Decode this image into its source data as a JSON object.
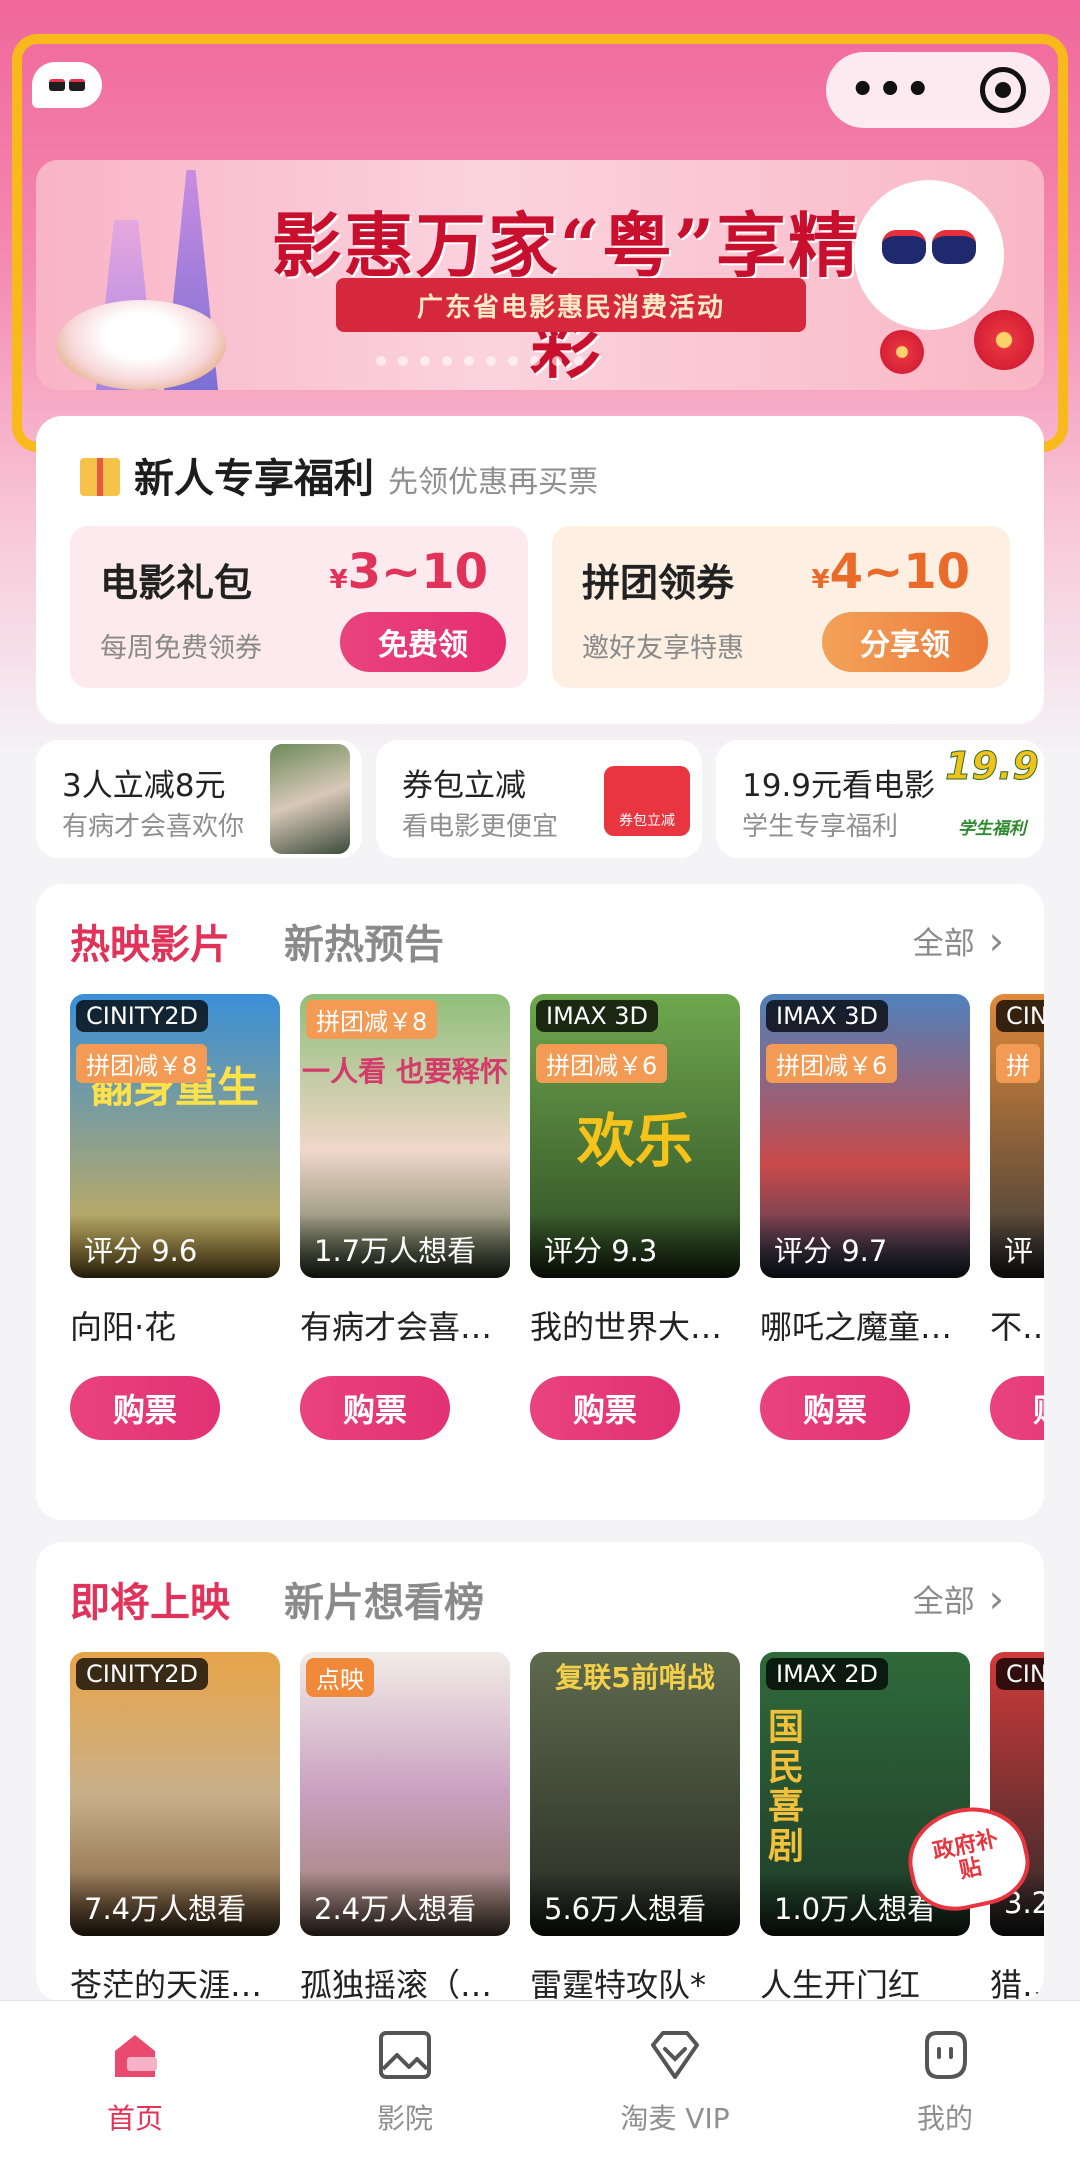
{
  "banner": {
    "headline": "影惠万家“粤”享精彩",
    "subline": "广东省电影惠民消费活动"
  },
  "newuser": {
    "title": "新人专享福利",
    "subtitle": "先领优惠再买票",
    "coupons": [
      {
        "name": "电影礼包",
        "desc": "每周免费领券",
        "price": "3~10",
        "currency": "¥",
        "button": "免费领"
      },
      {
        "name": "拼团领券",
        "desc": "邀好友享特惠",
        "price": "4~10",
        "currency": "¥",
        "button": "分享领"
      }
    ]
  },
  "promos": [
    {
      "title": "3人立减8元",
      "sub": "有病才会喜欢你"
    },
    {
      "title": "券包立减",
      "sub": "看电影更便宜",
      "thumb_text": "券包立减"
    },
    {
      "title": "19.9元看电影",
      "sub": "学生专享福利",
      "badge": "19.9",
      "badge_sub": "学生福利"
    }
  ],
  "now_showing": {
    "tab_active": "热映影片",
    "tab_inactive": "新热预告",
    "all_label": "全部",
    "buy_label": "购票",
    "movies": [
      {
        "format": "CINITY2D",
        "tag": "拼团减￥8",
        "meta": "评分 9.6",
        "title": "向阳·花",
        "color1": "#3a8fd8",
        "color2": "#d8b04a",
        "poster_text": "翻身重生"
      },
      {
        "format": "",
        "tag": "拼团减￥8",
        "meta": "1.7万人想看",
        "title": "有病才会喜…",
        "color1": "#7fae6a",
        "color2": "#f0d7c9",
        "poster_text": "一人看 也要释怀"
      },
      {
        "format": "IMAX 3D",
        "tag": "拼团减￥6",
        "meta": "评分 9.3",
        "title": "我的世界大…",
        "color1": "#5b8e3e",
        "color2": "#2d4a23",
        "poster_text": "欢乐"
      },
      {
        "format": "IMAX 3D",
        "tag": "拼团减￥6",
        "meta": "评分 9.7",
        "title": "哪吒之魔童…",
        "color1": "#3e6fa8",
        "color2": "#c94a4a",
        "poster_text": ""
      },
      {
        "format": "CIN",
        "tag": "拼",
        "meta": "评",
        "title": "不说",
        "color1": "#e08a3a",
        "color2": "#3a3a3a",
        "poster_text": ""
      }
    ]
  },
  "coming_soon": {
    "tab_active": "即将上映",
    "tab_inactive": "新片想看榜",
    "all_label": "全部",
    "movies": [
      {
        "format": "CINITY2D",
        "tag": "",
        "meta": "7.4万人想看",
        "title": "苍茫的天涯…",
        "color1": "#e8a448",
        "color2": "#7a5a3a"
      },
      {
        "format": "",
        "tag": "点映",
        "meta": "2.4万人想看",
        "title": "孤独摇滚（…",
        "color1": "#e8e0d8",
        "color2": "#9a7f6a"
      },
      {
        "format": "",
        "tag": "",
        "meta": "5.6万人想看",
        "title": "雷霆特攻队*",
        "color1": "#4d5642",
        "color2": "#262b22",
        "poster_text": "复联5前哨战"
      },
      {
        "format": "IMAX 2D",
        "tag": "",
        "meta": "1.0万人想看",
        "title": "人生开门红",
        "color1": "#2f6a3a",
        "color2": "#1e3a28",
        "poster_text": "国民喜剧",
        "badge": "政府补贴"
      },
      {
        "format": "CIN",
        "tag": "",
        "meta": "3.2",
        "title": "猎金",
        "color1": "#d23a3a",
        "color2": "#2a2a2a"
      }
    ]
  },
  "tabbar": {
    "items": [
      {
        "label": "首页",
        "active": true
      },
      {
        "label": "影院",
        "active": false
      },
      {
        "label": "淘麦 VIP",
        "active": false
      },
      {
        "label": "我的",
        "active": false
      }
    ]
  }
}
